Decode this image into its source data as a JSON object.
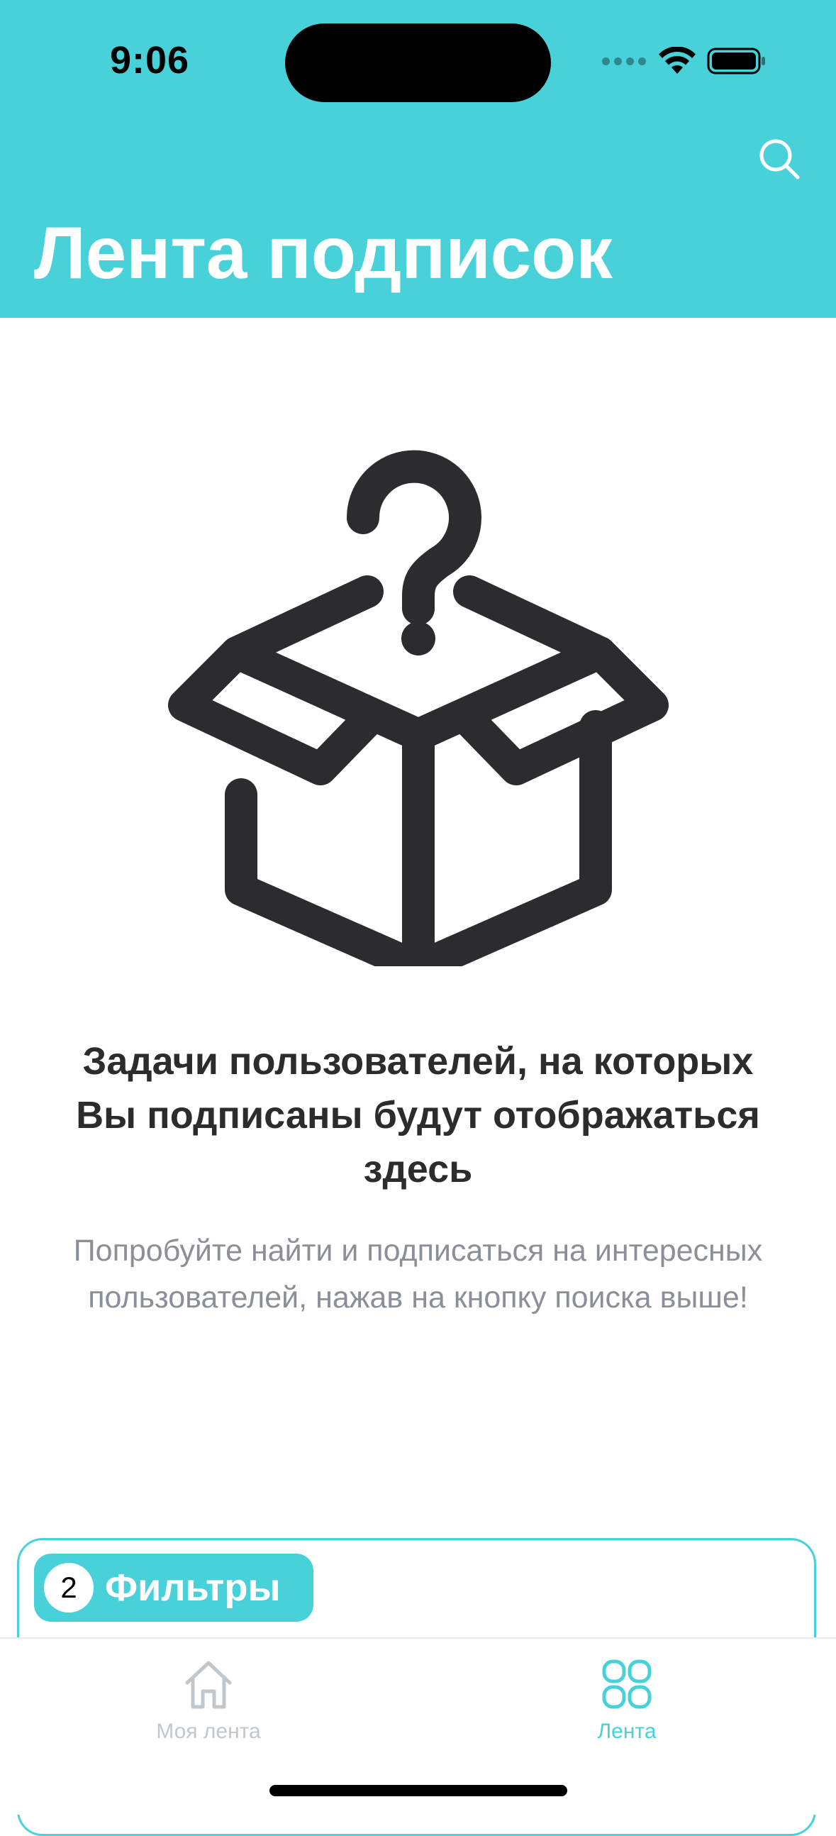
{
  "status_bar": {
    "time": "9:06"
  },
  "header": {
    "title": "Лента подписок",
    "background_color": "#48d1d9",
    "search_icon": "search-icon"
  },
  "empty_state": {
    "icon": "question-box-icon",
    "title": "Задачи пользователей, на которых Вы подписаны будут отображаться здесь",
    "subtitle": "Попробуйте найти и подписаться на интересных пользователей, нажав на кнопку поиска выше!"
  },
  "filters": {
    "count": "2",
    "label": "Фильтры"
  },
  "tab_bar": {
    "items": [
      {
        "label": "Моя лента",
        "icon": "home-icon",
        "active": false
      },
      {
        "label": "Лента",
        "icon": "grid-icon",
        "active": true
      }
    ],
    "active_color": "#48d1d9",
    "inactive_color": "#c2c7cc"
  }
}
